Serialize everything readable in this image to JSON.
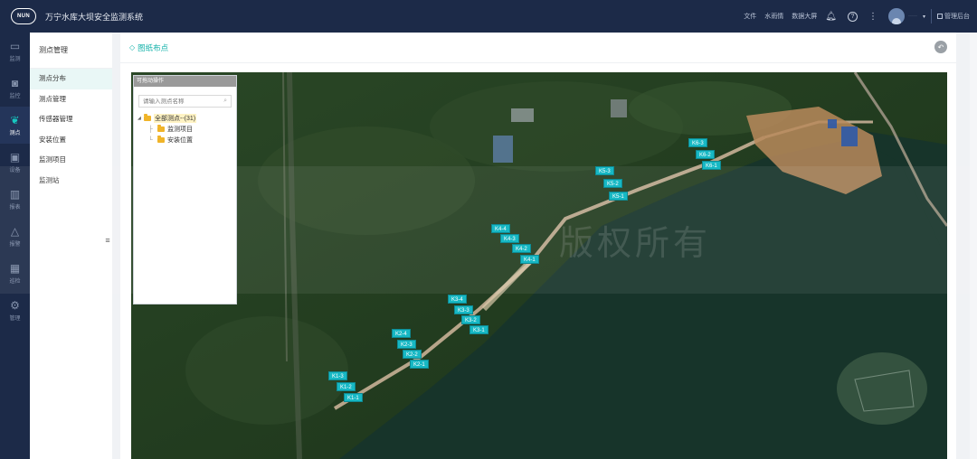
{
  "header": {
    "logo_text": "NUN",
    "title": "万宁水库大坝安全监测系统",
    "links": [
      "文件",
      "水雨情",
      "数据大屏"
    ],
    "user_name": "·····",
    "admin_label": "管理后台",
    "icons": [
      "bell-icon",
      "help-icon",
      "more-icon"
    ]
  },
  "iconnav": {
    "items": [
      {
        "label": "监测",
        "icon": "monitor-icon"
      },
      {
        "label": "监控",
        "icon": "camera-icon"
      },
      {
        "label": "测点",
        "icon": "pin-icon"
      },
      {
        "label": "设备",
        "icon": "device-icon"
      },
      {
        "label": "报表",
        "icon": "chart-icon"
      },
      {
        "label": "报警",
        "icon": "bell-icon"
      },
      {
        "label": "巡检",
        "icon": "calendar-icon"
      },
      {
        "label": "管理",
        "icon": "gear-icon"
      }
    ],
    "active": "测点"
  },
  "submenu": {
    "title": "测点管理",
    "items": [
      "测点分布",
      "测点管理",
      "传感器管理",
      "安装位置",
      "监测项目",
      "监测站"
    ],
    "active": "测点分布"
  },
  "page": {
    "title": "图纸布点"
  },
  "tree_panel": {
    "title": "可拖动操作",
    "search_placeholder": "请输入测点名称",
    "root_label": "全部测点--(31)",
    "children": [
      "监测项目",
      "安装位置"
    ]
  },
  "map": {
    "watermark": "版权所有",
    "colors": {
      "marker": "#17b8c4",
      "water": "#1a3a2c"
    },
    "markers": [
      "K1-3",
      "K1-2",
      "K1-1",
      "K2-4",
      "K2-3",
      "K2-2",
      "K2-1",
      "K3-4",
      "K3-3",
      "K3-2",
      "K3-1",
      "K4-4",
      "K4-3",
      "K4-2",
      "K4-1",
      "K5-3",
      "K5-2",
      "K5-1",
      "K6-3",
      "K6-2",
      "K6-1"
    ]
  }
}
